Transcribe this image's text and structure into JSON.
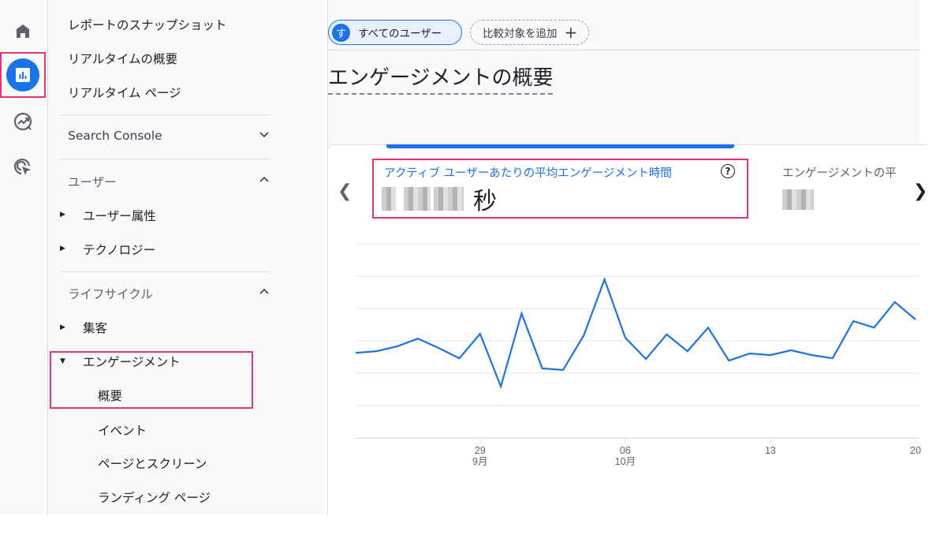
{
  "rail": {
    "items": [
      {
        "name": "home",
        "icon": "home-icon"
      },
      {
        "name": "reports",
        "icon": "bar-chart-icon",
        "active": true
      },
      {
        "name": "explore",
        "icon": "explore-trend-icon"
      },
      {
        "name": "advertising",
        "icon": "target-cursor-icon"
      }
    ],
    "accent_color": "#1a73e8",
    "highlight_color": "#e8336d"
  },
  "nav": {
    "top_items": [
      "レポートのスナップショット",
      "リアルタイムの概要",
      "リアルタイム ページ"
    ],
    "search_console": "Search Console",
    "user_section": {
      "title": "ユーザー",
      "items": [
        "ユーザー属性",
        "テクノロジー"
      ]
    },
    "lifecycle_section": {
      "title": "ライフサイクル",
      "items": [
        {
          "label": "集客",
          "expanded": false
        },
        {
          "label": "エンゲージメント",
          "expanded": true,
          "children": [
            "概要",
            "イベント",
            "ページとスクリーン",
            "ランディング ページ"
          ]
        }
      ]
    },
    "selected": "概要"
  },
  "main": {
    "comparison_chip": {
      "avatar": "す",
      "label": "すべてのユーザー"
    },
    "add_comparison": {
      "label": "比較対象を追加",
      "icon": "+"
    },
    "page_title": "エンゲージメントの概要",
    "card": {
      "metrics": [
        {
          "label": "アクティブ ユーザーあたりの平均エンゲージメント時間",
          "value": "(blurred)",
          "unit": "秒",
          "selected": true
        },
        {
          "label": "エンゲージメントの平",
          "value": "(blurred)"
        }
      ],
      "help_icon": "?"
    }
  },
  "chart_data": {
    "type": "line",
    "title": "アクティブ ユーザーあたりの平均エンゲージメント時間",
    "xlabel": "",
    "ylabel": "",
    "y_units": "gridline steps (y-axis labels not visible)",
    "ylim": [
      0,
      6
    ],
    "grid": true,
    "x_ticks": [
      {
        "day": "29",
        "month": "9月",
        "index": 6
      },
      {
        "day": "06",
        "month": "10月",
        "index": 13
      },
      {
        "day": "13",
        "month": "",
        "index": 20
      },
      {
        "day": "20",
        "month": "",
        "index": 27
      }
    ],
    "x": [
      "09-23",
      "09-24",
      "09-25",
      "09-26",
      "09-27",
      "09-28",
      "09-29",
      "09-30",
      "10-01",
      "10-02",
      "10-03",
      "10-04",
      "10-05",
      "10-06",
      "10-07",
      "10-08",
      "10-09",
      "10-10",
      "10-11",
      "10-12",
      "10-13",
      "10-14",
      "10-15",
      "10-16",
      "10-17",
      "10-18",
      "10-19",
      "10-20"
    ],
    "series": [
      {
        "name": "アクティブ ユーザーあたりの平均エンゲージメント時間",
        "color": "#1a73e8",
        "values": [
          2.63,
          2.68,
          2.83,
          3.07,
          2.78,
          2.46,
          3.22,
          1.59,
          3.85,
          2.15,
          2.1,
          3.17,
          4.9,
          3.1,
          2.44,
          3.2,
          2.68,
          3.41,
          2.39,
          2.61,
          2.56,
          2.71,
          2.56,
          2.46,
          3.61,
          3.41,
          4.2,
          3.66
        ]
      }
    ]
  }
}
